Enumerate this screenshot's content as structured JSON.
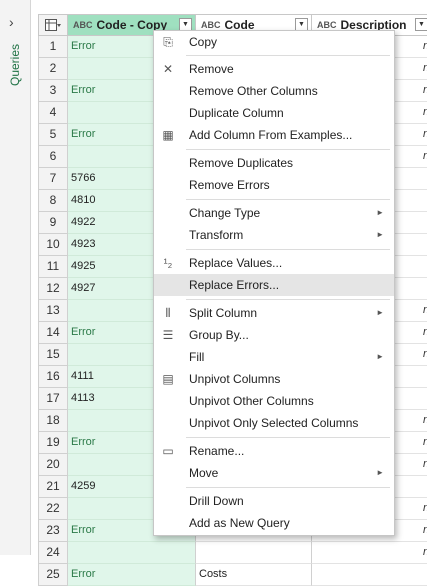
{
  "queries_pane": {
    "label": "Queries"
  },
  "columns": [
    {
      "type_icon": "ABC",
      "name": "Code - Copy"
    },
    {
      "type_icon": "ABC",
      "name": "Code"
    },
    {
      "type_icon": "ABC",
      "name": "Description"
    }
  ],
  "rows": [
    {
      "num": "1",
      "copy": "Error",
      "code": "",
      "desc": "nu"
    },
    {
      "num": "2",
      "copy": "",
      "code": "",
      "desc": "nu"
    },
    {
      "num": "3",
      "copy": "Error",
      "code": "",
      "desc": "nu"
    },
    {
      "num": "4",
      "copy": "",
      "code": "",
      "desc": "nu"
    },
    {
      "num": "5",
      "copy": "Error",
      "code": "",
      "desc": "nu"
    },
    {
      "num": "6",
      "copy": "",
      "code": "",
      "desc": "nu"
    },
    {
      "num": "7",
      "copy": "5766",
      "code": "",
      "desc": ""
    },
    {
      "num": "8",
      "copy": "4810",
      "code": "",
      "desc": ""
    },
    {
      "num": "9",
      "copy": "4922",
      "code": "",
      "desc": ""
    },
    {
      "num": "10",
      "copy": "4923",
      "code": "",
      "desc": ""
    },
    {
      "num": "11",
      "copy": "4925",
      "code": "",
      "desc": ""
    },
    {
      "num": "12",
      "copy": "4927",
      "code": "",
      "desc": ""
    },
    {
      "num": "13",
      "copy": "",
      "code": "",
      "desc": "nu"
    },
    {
      "num": "14",
      "copy": "Error",
      "code": "",
      "desc": "nu"
    },
    {
      "num": "15",
      "copy": "",
      "code": "",
      "desc": "nu"
    },
    {
      "num": "16",
      "copy": "4111",
      "code": "",
      "desc": ""
    },
    {
      "num": "17",
      "copy": "4113",
      "code": "",
      "desc": ""
    },
    {
      "num": "18",
      "copy": "",
      "code": "",
      "desc": "nu"
    },
    {
      "num": "19",
      "copy": "Error",
      "code": "",
      "desc": "nu"
    },
    {
      "num": "20",
      "copy": "",
      "code": "",
      "desc": "nu"
    },
    {
      "num": "21",
      "copy": "4259",
      "code": "",
      "desc": ""
    },
    {
      "num": "22",
      "copy": "",
      "code": "",
      "desc": "nu"
    },
    {
      "num": "23",
      "copy": "Error",
      "code": "",
      "desc": "nu"
    },
    {
      "num": "24",
      "copy": "",
      "code": "",
      "desc": "nu"
    },
    {
      "num": "25",
      "copy": "Error",
      "code": "Costs",
      "desc": ""
    }
  ],
  "context_menu": {
    "items": [
      {
        "label": "Copy",
        "icon": "copy-icon",
        "glyph": "⎘"
      },
      {
        "label": "Remove",
        "icon": "remove-column-icon",
        "glyph": "✕"
      },
      {
        "label": "Remove Other Columns"
      },
      {
        "label": "Duplicate Column"
      },
      {
        "label": "Add Column From Examples...",
        "icon": "column-from-examples-icon",
        "glyph": "▦"
      },
      {
        "label": "Remove Duplicates"
      },
      {
        "label": "Remove Errors"
      },
      {
        "label": "Change Type",
        "submenu": true
      },
      {
        "label": "Transform",
        "submenu": true
      },
      {
        "label": "Replace Values...",
        "icon": "replace-values-icon",
        "glyph": "¹₂"
      },
      {
        "label": "Replace Errors...",
        "highlighted": true
      },
      {
        "label": "Split Column",
        "icon": "split-column-icon",
        "glyph": "⫴",
        "submenu": true
      },
      {
        "label": "Group By...",
        "icon": "group-by-icon",
        "glyph": "☰"
      },
      {
        "label": "Fill",
        "submenu": true
      },
      {
        "label": "Unpivot Columns",
        "icon": "unpivot-icon",
        "glyph": "▤"
      },
      {
        "label": "Unpivot Other Columns"
      },
      {
        "label": "Unpivot Only Selected Columns"
      },
      {
        "label": "Rename...",
        "icon": "rename-icon",
        "glyph": "▭"
      },
      {
        "label": "Move",
        "submenu": true
      },
      {
        "label": "Drill Down"
      },
      {
        "label": "Add as New Query"
      }
    ]
  }
}
